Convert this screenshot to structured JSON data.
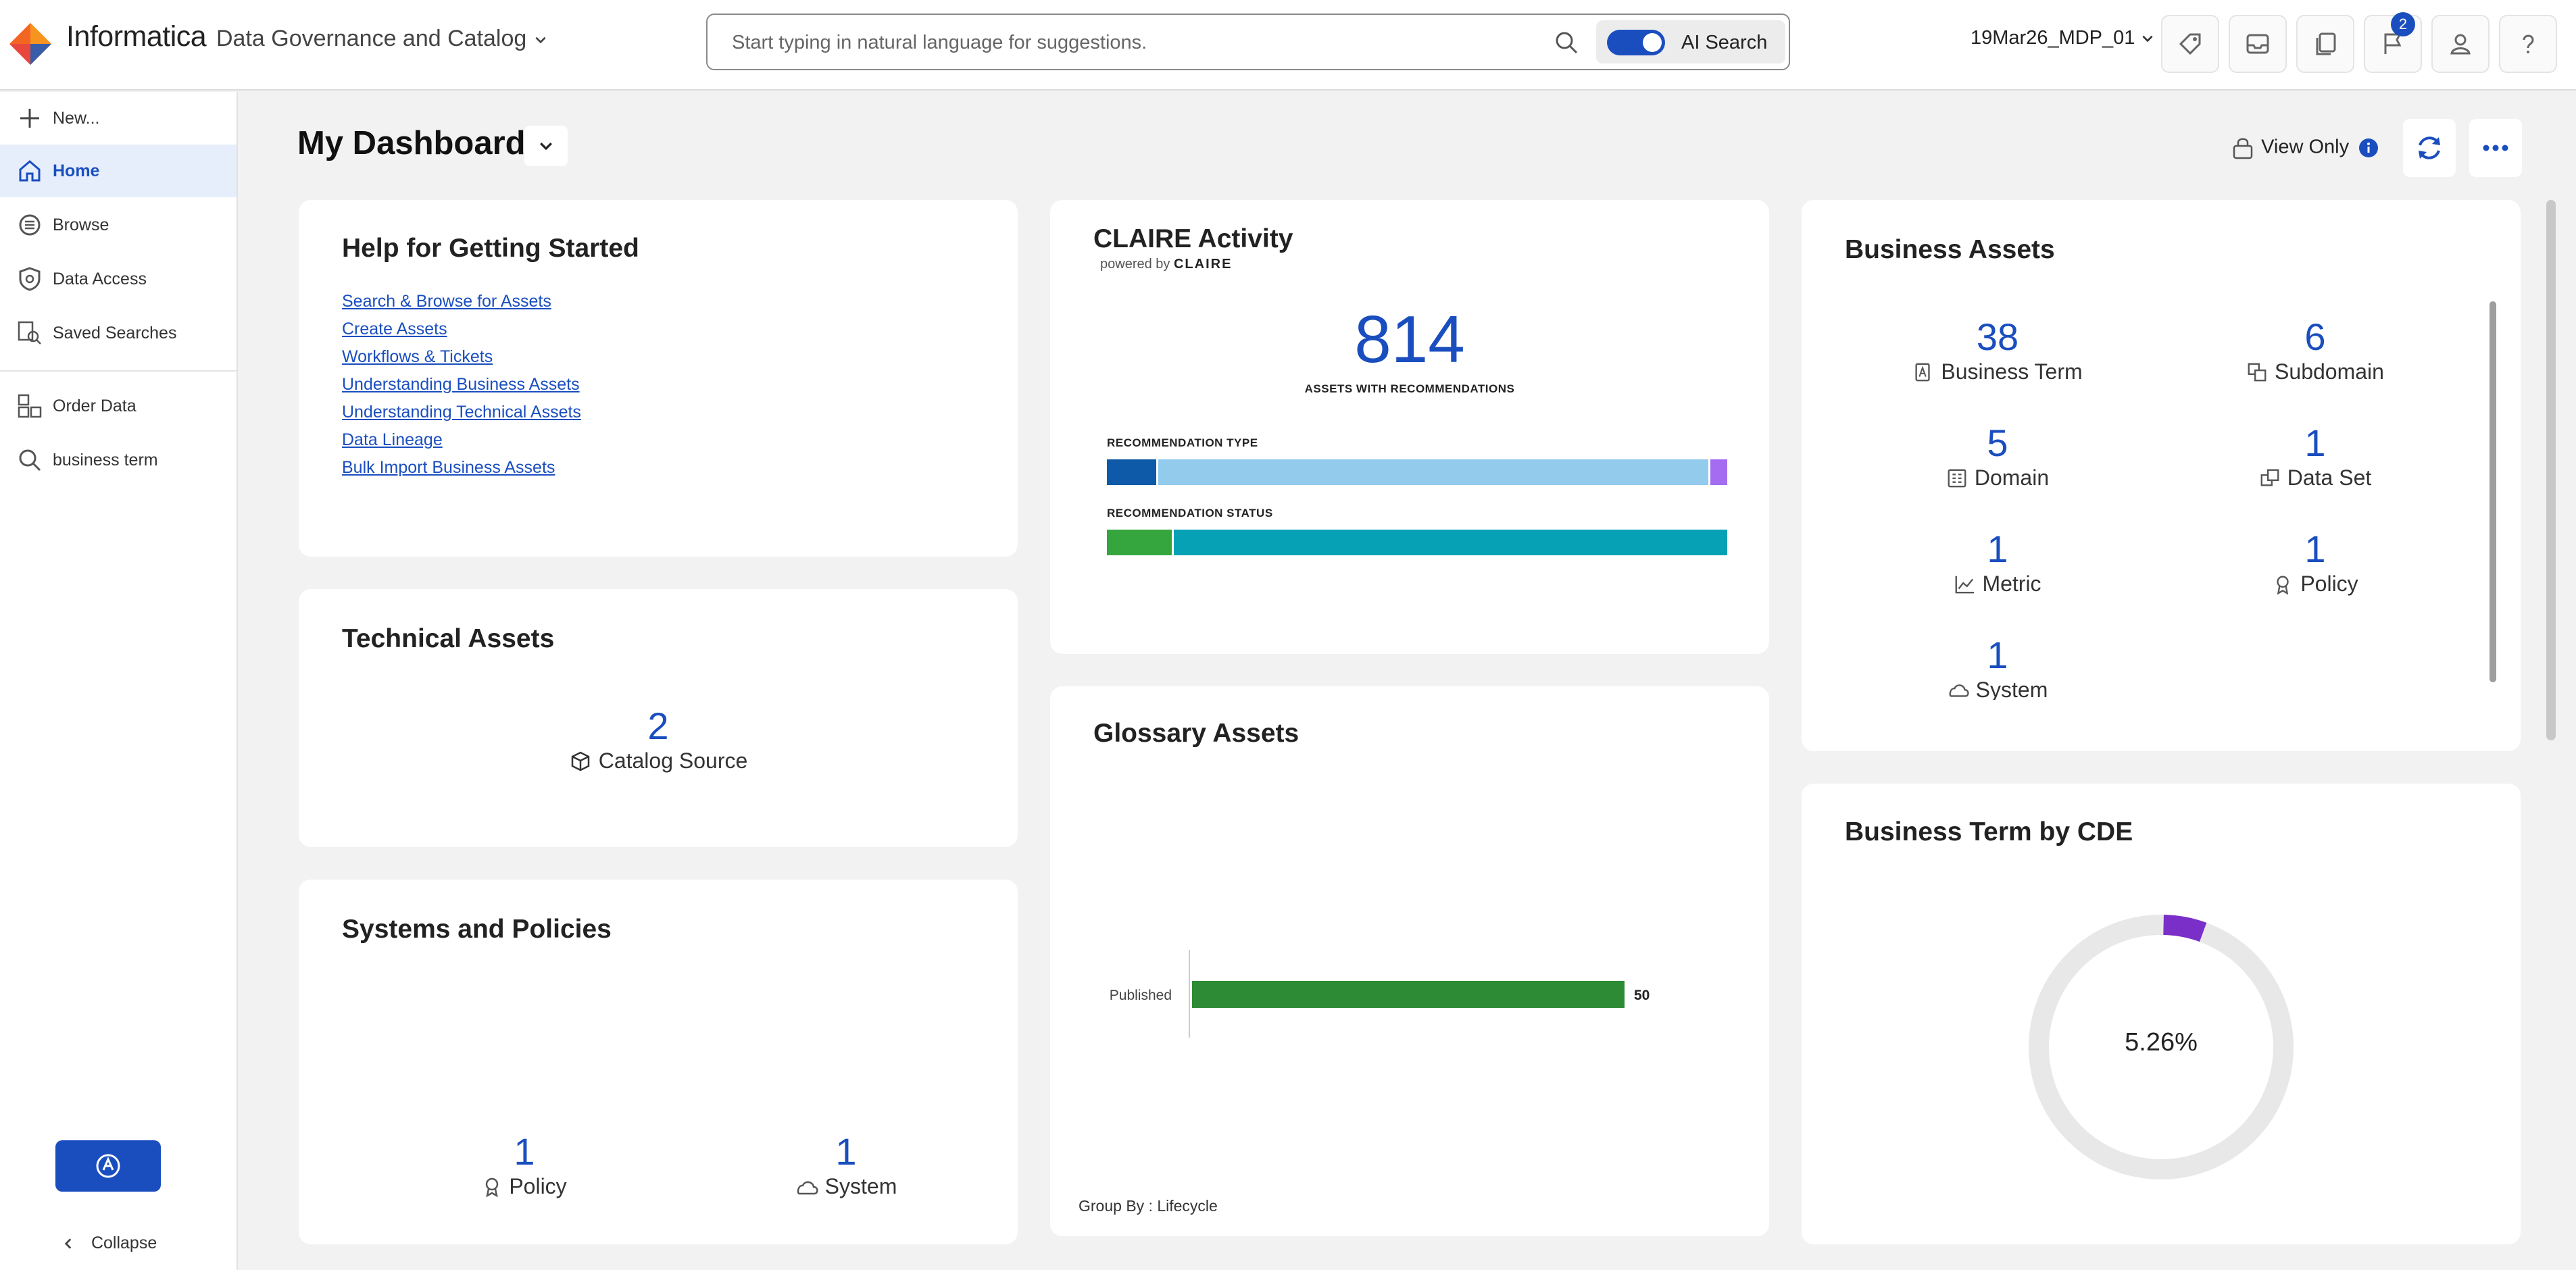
{
  "header": {
    "brand": "Informatica",
    "product": "Data Governance and Catalog",
    "search_placeholder": "Start typing in natural language for suggestions.",
    "ai_search_label": "AI Search",
    "org": "19Mar26_MDP_01",
    "notifications_count": "2"
  },
  "sidebar": {
    "new": "New...",
    "home": "Home",
    "browse": "Browse",
    "data_access": "Data Access",
    "saved_searches": "Saved Searches",
    "order_data": "Order Data",
    "recent_search": "business term",
    "collapse": "Collapse"
  },
  "page": {
    "title": "My Dashboard",
    "view_only": "View Only"
  },
  "help": {
    "title": "Help for Getting Started",
    "links": [
      "Search & Browse for Assets",
      "Create Assets",
      "Workflows & Tickets",
      "Understanding Business Assets",
      "Understanding Technical Assets",
      "Data Lineage",
      "Bulk Import Business Assets"
    ]
  },
  "technical": {
    "title": "Technical Assets",
    "count": "2",
    "label": "Catalog Source"
  },
  "systems": {
    "title": "Systems and Policies",
    "policy_count": "1",
    "policy_label": "Policy",
    "system_count": "1",
    "system_label": "System"
  },
  "claire": {
    "title": "CLAIRE Activity",
    "powered_by": "powered by",
    "powered_brand": "CLAIRE",
    "count": "814",
    "count_label": "ASSETS WITH RECOMMENDATIONS",
    "type_label": "RECOMMENDATION TYPE",
    "status_label": "RECOMMENDATION STATUS",
    "type_segments": [
      {
        "fraction": 0.083,
        "color": "#0f5aa8"
      },
      {
        "fraction": 0.89,
        "color": "#93cbec"
      },
      {
        "fraction": 0.027,
        "color": "#a46cf0"
      }
    ],
    "status_segments": [
      {
        "fraction": 0.108,
        "color": "#35a53e"
      },
      {
        "fraction": 0.892,
        "color": "#06a1b5"
      }
    ]
  },
  "glossary": {
    "title": "Glossary Assets",
    "group_by": "Group By : Lifecycle",
    "chart_data": {
      "type": "bar",
      "orientation": "horizontal",
      "categories": [
        "Published"
      ],
      "values": [
        50
      ],
      "value_labels": [
        "50"
      ],
      "color": "#2e8b35"
    }
  },
  "business": {
    "title": "Business Assets",
    "items": [
      {
        "count": "38",
        "label": "Business Term",
        "icon": "business-term-icon"
      },
      {
        "count": "6",
        "label": "Subdomain",
        "icon": "subdomain-icon"
      },
      {
        "count": "5",
        "label": "Domain",
        "icon": "domain-icon"
      },
      {
        "count": "1",
        "label": "Data Set",
        "icon": "data-set-icon"
      },
      {
        "count": "1",
        "label": "Metric",
        "icon": "metric-icon"
      },
      {
        "count": "1",
        "label": "Policy",
        "icon": "policy-icon"
      },
      {
        "count": "1",
        "label": "System",
        "icon": "system-icon"
      }
    ]
  },
  "cde": {
    "title": "Business Term by CDE",
    "center_label": "5.26%",
    "chart_data": {
      "type": "pie",
      "variant": "donut",
      "values": [
        5.26,
        94.74
      ],
      "colors": [
        "#7a2fc8",
        "#e8e8e8"
      ]
    }
  }
}
